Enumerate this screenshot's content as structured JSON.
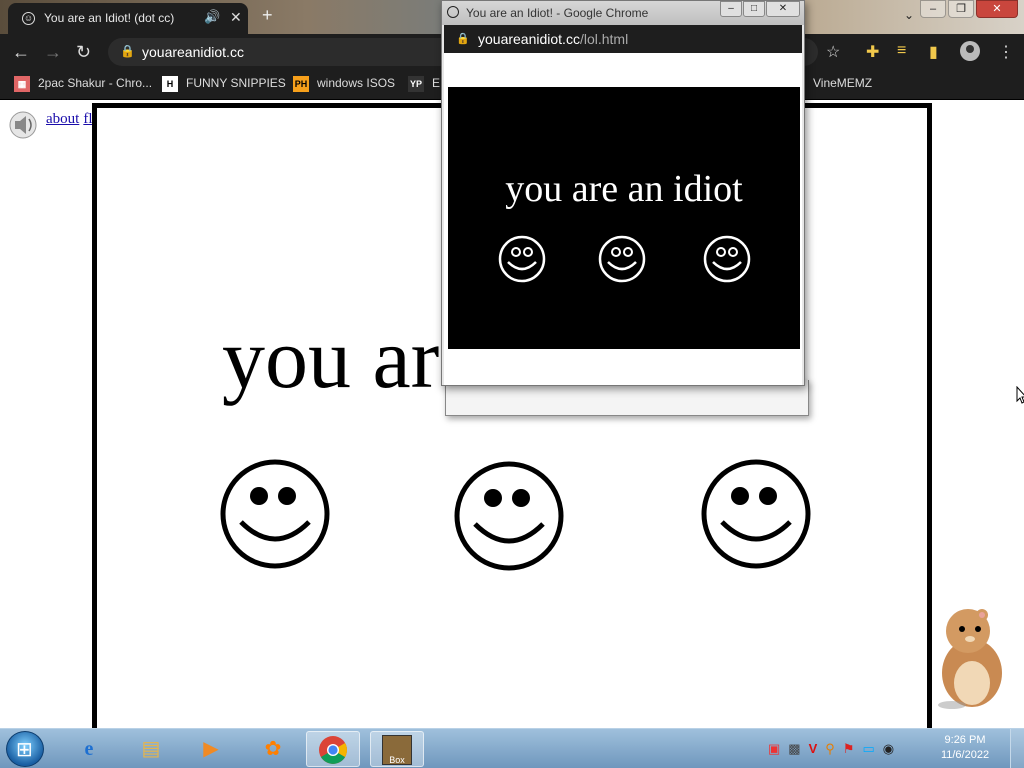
{
  "main_window": {
    "tab": {
      "title": "You are an Idiot! (dot cc)"
    },
    "omnibox": {
      "url": "youareanidiot.cc"
    },
    "bookmarks": [
      {
        "label": "2pac Shakur - Chro...",
        "icon": "bookmark-icon",
        "color": "#e06666"
      },
      {
        "label": "FUNNY SNIPPIES",
        "icon": "H",
        "color": "#ffffff"
      },
      {
        "label": "windows ISOS",
        "icon": "PH",
        "color": "#f7a01b"
      },
      {
        "label": "E",
        "icon": "YP",
        "color": "#333333"
      },
      {
        "label": "VineMEMZ",
        "icon": "vine-icon",
        "color": "#c0392b"
      }
    ]
  },
  "page": {
    "links": {
      "about": "about",
      "flash": "flash"
    },
    "big_text": "you ar",
    "smiley_count": 3
  },
  "popup": {
    "title": "You are an Idiot! - Google Chrome",
    "url_host": "youareanidiot.cc",
    "url_path": "/lol.html",
    "text": "you are an idiot"
  },
  "taskbar": {
    "time": "9:26 PM",
    "date": "11/6/2022",
    "programs": [
      "ie-icon",
      "explorer-icon",
      "media-player-icon",
      "uc-browser-icon",
      "chrome-icon",
      "bonzi-box-icon"
    ]
  },
  "colors": {
    "chrome_dark": "#1e1e1e",
    "accent_yellow": "#f2c94c",
    "link_blue": "#1a0dab"
  }
}
